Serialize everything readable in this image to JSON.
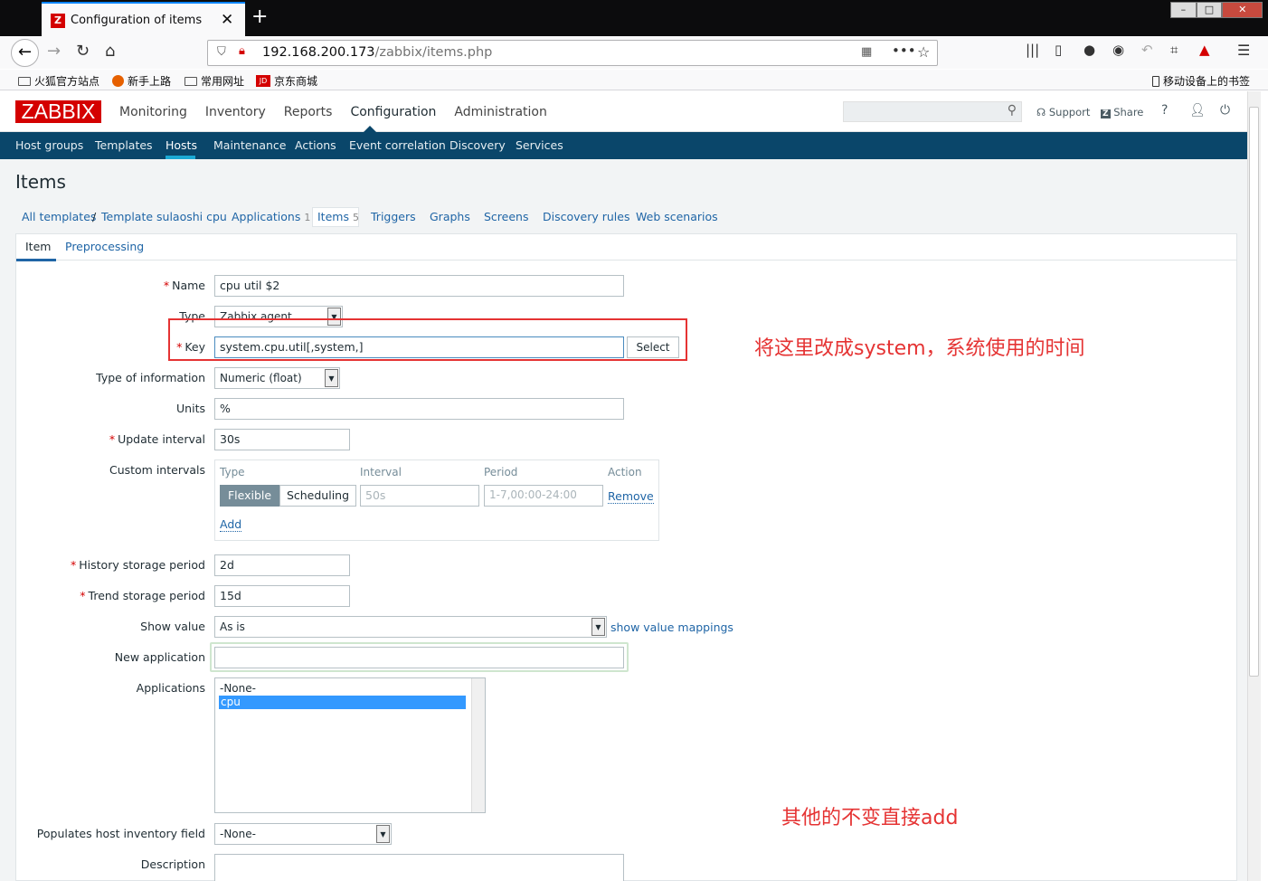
{
  "browser": {
    "tab_title": "Configuration of items",
    "tab_favicon": "Z",
    "url_host": "192.168.200.173",
    "url_path": "/zabbix/items.php"
  },
  "bookmarks": [
    "火狐官方站点",
    "新手上路",
    "常用网址",
    "京东商城"
  ],
  "bookmarks_right": "移动设备上的书签",
  "zabbix": {
    "logo": "ZABBIX",
    "menu": [
      "Monitoring",
      "Inventory",
      "Reports",
      "Configuration",
      "Administration"
    ],
    "support": "Support",
    "share": "Share",
    "help": "?",
    "submenu": [
      "Host groups",
      "Templates",
      "Hosts",
      "Maintenance",
      "Actions",
      "Event correlation",
      "Discovery",
      "Services"
    ],
    "page_title": "Items",
    "breadcrumbs": {
      "all_templates": "All templates",
      "separator": "/",
      "template": "Template sulaoshi cpu",
      "applications": "Applications",
      "applications_count": "1",
      "items": "Items",
      "items_count": "5",
      "triggers": "Triggers",
      "graphs": "Graphs",
      "screens": "Screens",
      "discovery_rules": "Discovery rules",
      "web_scenarios": "Web scenarios"
    },
    "form_tabs": [
      "Item",
      "Preprocessing"
    ],
    "form": {
      "name_label": "Name",
      "name_value": "cpu util $2",
      "type_label": "Type",
      "type_value": "Zabbix agent",
      "key_label": "Key",
      "key_value": "system.cpu.util[,system,]",
      "select_button": "Select",
      "type_info_label": "Type of information",
      "type_info_value": "Numeric (float)",
      "units_label": "Units",
      "units_value": "%",
      "update_label": "Update interval",
      "update_value": "30s",
      "custom_label": "Custom intervals",
      "ci_headers": [
        "Type",
        "Interval",
        "Period",
        "Action"
      ],
      "ci_flexible": "Flexible",
      "ci_scheduling": "Scheduling",
      "ci_interval_placeholder": "50s",
      "ci_period_placeholder": "1-7,00:00-24:00",
      "ci_remove": "Remove",
      "ci_add": "Add",
      "history_label": "History storage period",
      "history_value": "2d",
      "trend_label": "Trend storage period",
      "trend_value": "15d",
      "show_value_label": "Show value",
      "show_value_value": "As is",
      "show_mappings": "show value mappings",
      "new_app_label": "New application",
      "new_app_value": "",
      "apps_label": "Applications",
      "apps_options": [
        "-None-",
        "cpu"
      ],
      "inventory_label": "Populates host inventory field",
      "inventory_value": "-None-",
      "description_label": "Description"
    }
  },
  "annotations": {
    "note1": "将这里改成system，系统使用的时间",
    "note2": "其他的不变直接add"
  }
}
